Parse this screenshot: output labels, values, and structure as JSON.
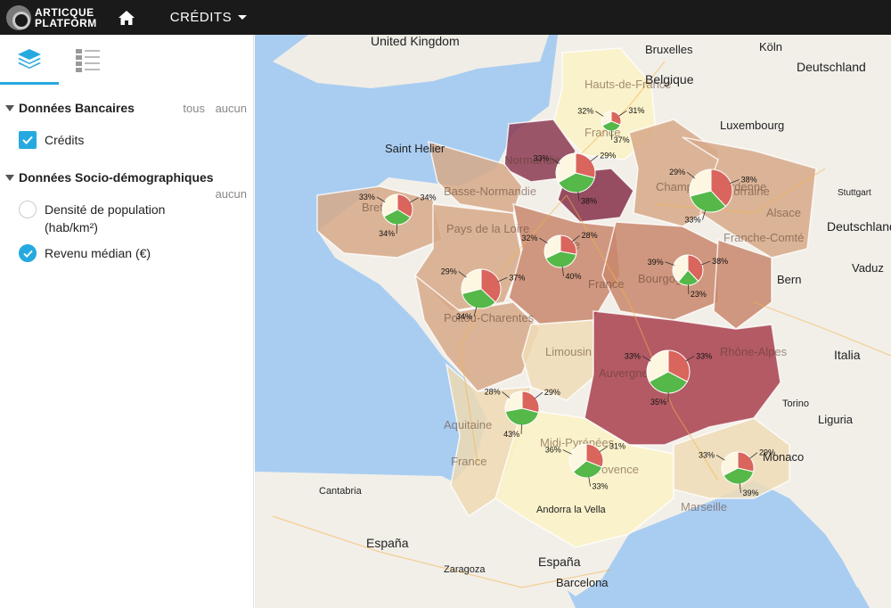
{
  "app": {
    "logo_line1": "ARTICQUE",
    "logo_line2": "PLATFORM",
    "menu_label": "CRÉDITS"
  },
  "sidebar": {
    "group1": {
      "title": "Données Bancaires",
      "link_all": "tous",
      "link_none": "aucun",
      "items": [
        {
          "label": "Crédits",
          "checked": true
        }
      ]
    },
    "group2": {
      "title": "Données Socio-démographiques",
      "link_none": "aucun",
      "items": [
        {
          "label": "Densité de population (hab/km²)",
          "selected": false
        },
        {
          "label": "Revenu médian (€)",
          "selected": true
        }
      ]
    }
  },
  "map": {
    "places": [
      "United Kingdom",
      "Bruxelles",
      "Köln",
      "Deutschland",
      "Belgique",
      "Luxembourg",
      "Saint Helier",
      "Stuttgart",
      "Deutschland",
      "Bern",
      "Vaduz",
      "Italia",
      "Torino",
      "Liguria",
      "Monaco",
      "Cantabria",
      "España",
      "Zaragoza",
      "España",
      "Barcelona",
      "Andorra la Vella"
    ],
    "regions": [
      "Hauts-de-France",
      "Normandie",
      "Basse-Normandie",
      "Bretagne",
      "Pays de la Loire",
      "Centre",
      "Champagne-Ardenne",
      "Lorraine",
      "Alsace",
      "Franche-Comté",
      "Bourgogne",
      "Poitou-Charentes",
      "Limousin",
      "Auvergne",
      "Rhône-Alpes",
      "Aquitaine",
      "Midi-Pyrénées",
      "Provence",
      "France",
      "France",
      "France",
      "Marseille"
    ],
    "pies": [
      {
        "labels": [
          "31%",
          "37%",
          "32%"
        ]
      },
      {
        "labels": [
          "29%",
          "38%",
          "33%"
        ]
      },
      {
        "labels": [
          "34%",
          "34%",
          "33%"
        ]
      },
      {
        "labels": [
          "28%",
          "40%",
          "32%"
        ]
      },
      {
        "labels": [
          "38%",
          "33%",
          "29%"
        ]
      },
      {
        "labels": [
          "38%",
          "23%",
          "39%"
        ]
      },
      {
        "labels": [
          "37%",
          "34%",
          "29%"
        ]
      },
      {
        "labels": [
          "33%",
          "35%",
          "33%"
        ]
      },
      {
        "labels": [
          "29%",
          "43%",
          "28%"
        ]
      },
      {
        "labels": [
          "31%",
          "33%",
          "36%"
        ]
      },
      {
        "labels": [
          "29%",
          "39%",
          "33%"
        ]
      }
    ],
    "colors": {
      "red": "#d9655d",
      "green": "#55b848",
      "cream": "#fdf7e2"
    }
  }
}
